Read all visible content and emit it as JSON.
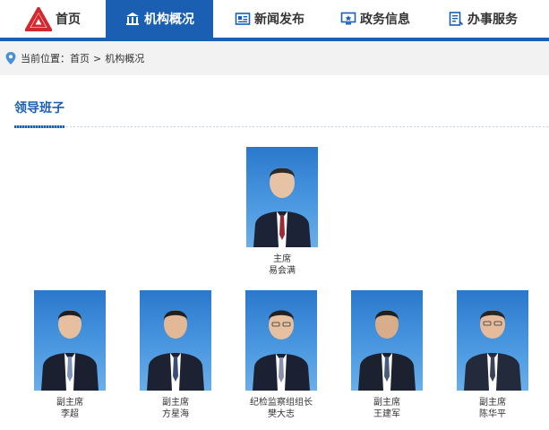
{
  "nav": {
    "items": [
      {
        "label": "首页",
        "icon": "home-logo"
      },
      {
        "label": "机构概况",
        "icon": "institution-icon",
        "active": true
      },
      {
        "label": "新闻发布",
        "icon": "news-icon"
      },
      {
        "label": "政务信息",
        "icon": "gov-info-icon"
      },
      {
        "label": "办事服务",
        "icon": "service-icon"
      }
    ],
    "brand_color": "#1b5fb3",
    "logo_color": "#d2282e"
  },
  "breadcrumb": {
    "prefix": "当前位置：",
    "home": "首页",
    "separator": ">",
    "current": "机构概况"
  },
  "section": {
    "title": "领导班子"
  },
  "leaders": [
    {
      "role": "主席",
      "name": "易会满"
    },
    {
      "role": "副主席",
      "name": "李超"
    },
    {
      "role": "副主席",
      "name": "方星海"
    },
    {
      "role": "纪检监察组组长",
      "name": "樊大志"
    },
    {
      "role": "副主席",
      "name": "王建军"
    },
    {
      "role": "副主席",
      "name": "陈华平"
    }
  ]
}
